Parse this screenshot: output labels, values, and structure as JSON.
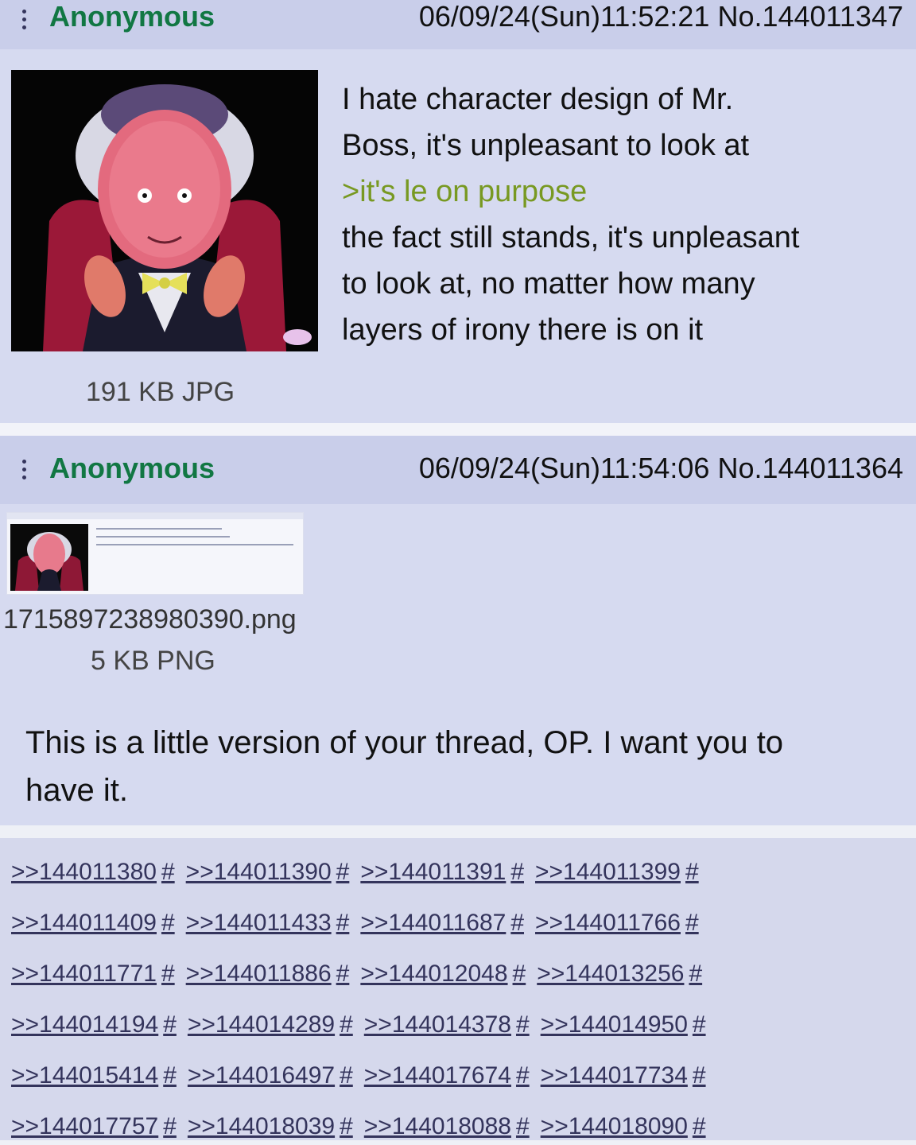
{
  "posts": [
    {
      "name": "Anonymous",
      "datetime": "06/09/24(Sun)11:52:21",
      "number": "No.144011347",
      "file_size": "191 KB JPG",
      "body_lines": [
        {
          "text": "I hate character design of Mr.",
          "green": false
        },
        {
          "text": "Boss, it's unpleasant to look at",
          "green": false
        },
        {
          "text": ">it's le on purpose",
          "green": true
        },
        {
          "text": "the fact still stands, it's unpleasant",
          "green": false
        },
        {
          "text": "to look at, no matter how many",
          "green": false
        },
        {
          "text": "layers of irony there is on it",
          "green": false
        }
      ]
    },
    {
      "name": "Anonymous",
      "datetime": "06/09/24(Sun)11:54:06",
      "number": "No.144011364",
      "file_name": "1715897238980390.png",
      "file_size": "5 KB PNG",
      "body_lines": [
        "This is a little version of your thread, OP. I want you to",
        "have it."
      ]
    }
  ],
  "replies": [
    [
      ">>144011380",
      ">>144011390",
      ">>144011391",
      ">>144011399"
    ],
    [
      ">>144011409",
      ">>144011433",
      ">>144011687",
      ">>144011766"
    ],
    [
      ">>144011771",
      ">>144011886",
      ">>144012048",
      ">>144013256"
    ],
    [
      ">>144014194",
      ">>144014289",
      ">>144014378",
      ">>144014950"
    ],
    [
      ">>144015414",
      ">>144016497",
      ">>144017674",
      ">>144017734"
    ],
    [
      ">>144017757",
      ">>144018039",
      ">>144018088",
      ">>144018090"
    ]
  ],
  "reply_hash": "#",
  "colors": {
    "name": "#117743",
    "greentext": "#789922",
    "post_bg": "#d6daf0",
    "link": "#34345c"
  }
}
